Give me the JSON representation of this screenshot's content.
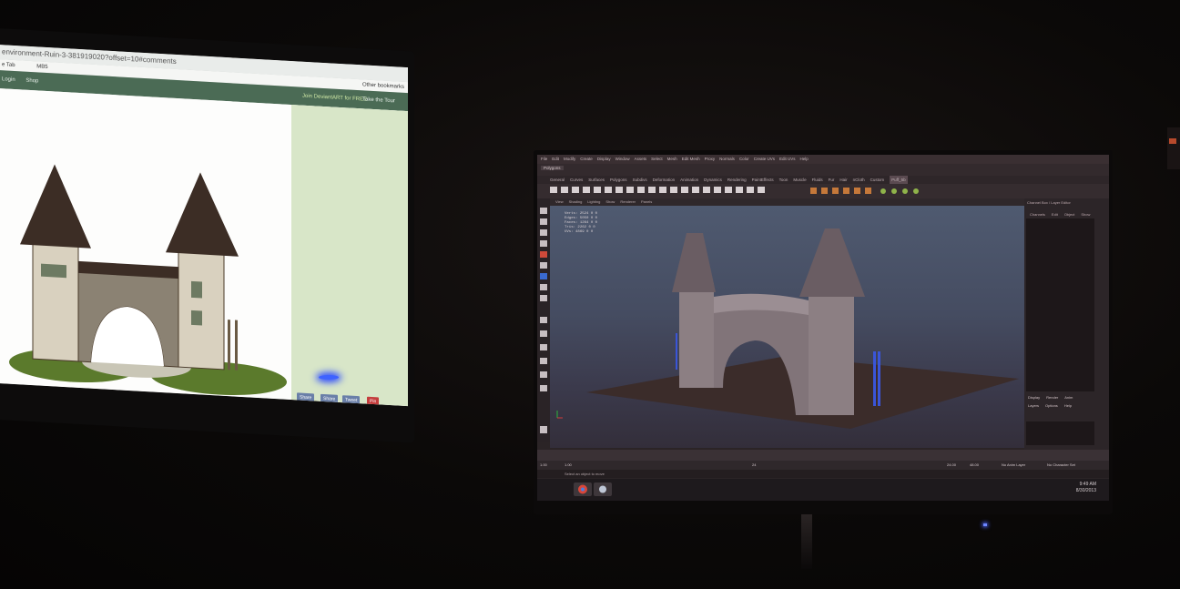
{
  "left_monitor": {
    "address_bar": "environment-Ruin-3-381919020?offset=10#comments",
    "bookmark_tab": "e Tab",
    "bookmark_item": "MB5",
    "other_bookmarks": "Other bookmarks",
    "nav_login": "Login",
    "nav_shop": "Shop",
    "join_text": "Join DeviantART for FREE",
    "tour_text": "Take the Tour",
    "share_buttons": [
      "Share",
      "Share",
      "Tweet",
      "Pin"
    ]
  },
  "right_monitor": {
    "menu_items": [
      "File",
      "Edit",
      "Modify",
      "Create",
      "Display",
      "Window",
      "Assets",
      "Select",
      "Mesh",
      "Edit Mesh",
      "Proxy",
      "Normals",
      "Color",
      "Create UVs",
      "Edit UVs",
      "Help"
    ],
    "mode_selector": "Polygons",
    "shelf_tabs": [
      "General",
      "Curves",
      "Surfaces",
      "Polygons",
      "Subdivs",
      "Deformation",
      "Animation",
      "Dynamics",
      "Rendering",
      "PaintEffects",
      "Toon",
      "Muscle",
      "Fluids",
      "Fur",
      "Hair",
      "nCloth",
      "Custom",
      "Puff_5b"
    ],
    "viewport_menu": [
      "View",
      "Shading",
      "Lighting",
      "Show",
      "Renderer",
      "Panels"
    ],
    "stats": [
      [
        "Verts:",
        "2524",
        "0",
        "0"
      ],
      [
        "Edges:",
        "5050",
        "0",
        "0"
      ],
      [
        "Faces:",
        "1264",
        "0",
        "0"
      ],
      [
        "Tris:",
        "2262",
        "0",
        "0"
      ],
      [
        "UVs:",
        "4869",
        "0",
        "0"
      ]
    ],
    "channel_box_title": "Channel Box / Layer Editor",
    "channel_menu": [
      "Channels",
      "Edit",
      "Object",
      "Show"
    ],
    "layer_tabs": [
      "Display",
      "Render",
      "Anim"
    ],
    "layer_menu": [
      "Layers",
      "Options",
      "Help"
    ],
    "range_start": "1.00",
    "range_end": "1.00",
    "range_mid": "24",
    "time_end": "24.00",
    "time_end2": "48.00",
    "anim_layer": "No Anim Layer",
    "character_set": "No Character Set",
    "help_line": "Select an object to move",
    "clock_time": "9:49 AM",
    "clock_date": "8/30/2013"
  }
}
